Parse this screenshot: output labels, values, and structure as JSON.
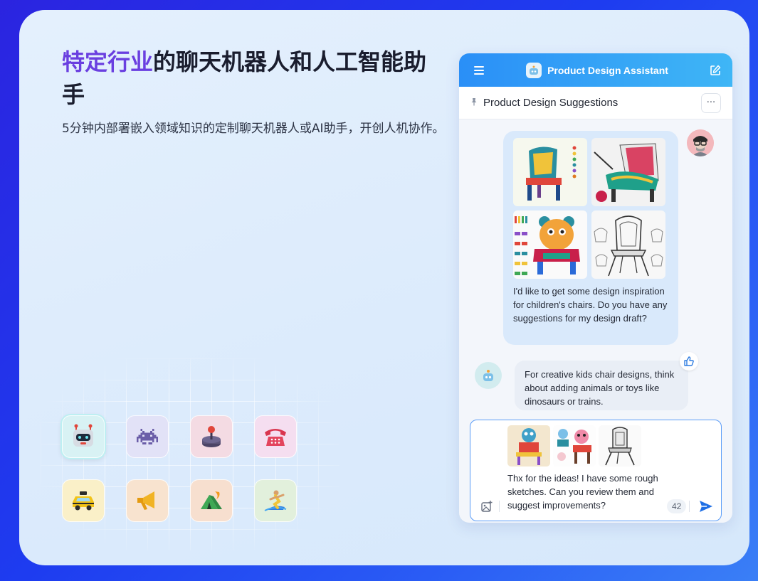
{
  "hero": {
    "headline_accent": "特定行业",
    "headline_rest": "的聊天机器人和人工智能助手",
    "subline": "5分钟内部署嵌入领域知识的定制聊天机器人或AI助手，开创人机协作。"
  },
  "icons": [
    "robot-icon",
    "space-invader-icon",
    "joystick-icon",
    "telephone-icon",
    "taxi-icon",
    "megaphone-icon",
    "tent-icon",
    "surfer-icon"
  ],
  "chat": {
    "app_title": "Product Design Assistant",
    "conversation_title": "Product Design Suggestions",
    "more_label": "···",
    "user_message": "I'd like to get some design inspiration for children's chairs. Do you have any suggestions for my design draft?",
    "bot_message": "For creative kids chair designs, think about adding animals or toys like dinosaurs or trains.",
    "composer_text": "Thx for the ideas! I have some rough sketches. Can you review them and suggest improvements?",
    "char_count": "42"
  },
  "colors": {
    "accent_purple": "#6a3fe0",
    "header_blue": "#2a8ff7",
    "send_blue": "#1f6fe5"
  }
}
